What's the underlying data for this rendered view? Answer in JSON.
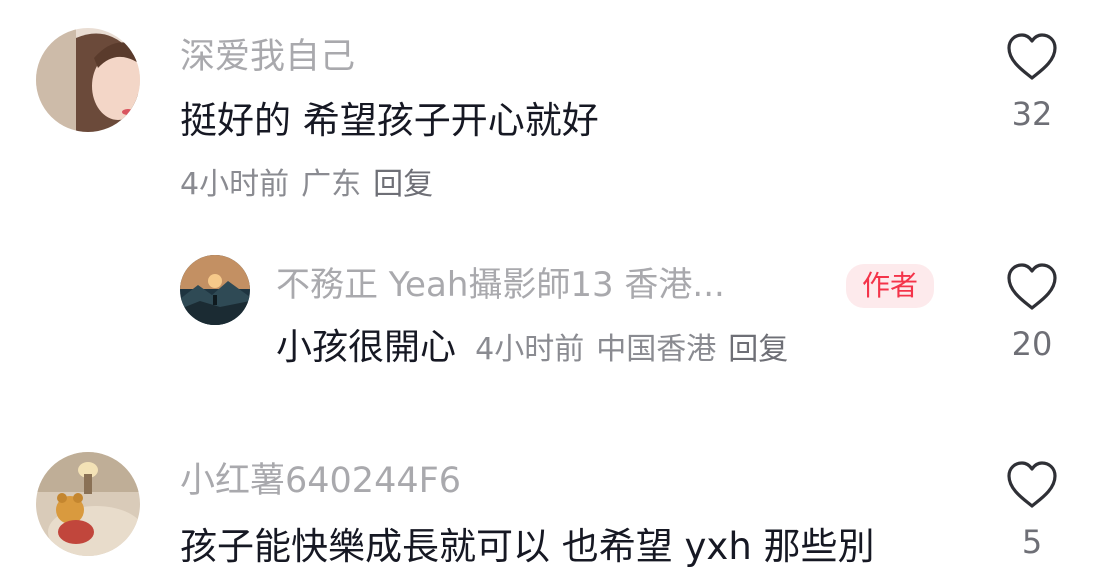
{
  "comments": [
    {
      "username": "深爱我自己",
      "text": "挺好的 希望孩子开心就好",
      "time": "4小时前",
      "location": "广东",
      "reply_label": "回复",
      "likes": "32",
      "avatar_icon": "avatar-woman-photo"
    },
    {
      "username": "不務正 Yeah攝影師13 香港...",
      "badge": "作者",
      "text": "小孩很開心",
      "time": "4小时前",
      "location": "中国香港",
      "reply_label": "回复",
      "likes": "20",
      "avatar_icon": "avatar-mountain-sunset"
    },
    {
      "username": "小红薯640244F6",
      "text": "孩子能快樂成長就可以 也希望 yxh 那些別",
      "likes": "5",
      "avatar_icon": "avatar-bear-bed"
    }
  ],
  "colors": {
    "username": "#a9a9ad",
    "text": "#161823",
    "meta": "#8a8b91",
    "badge_bg": "#fdeaec",
    "badge_text": "#f4344a"
  }
}
